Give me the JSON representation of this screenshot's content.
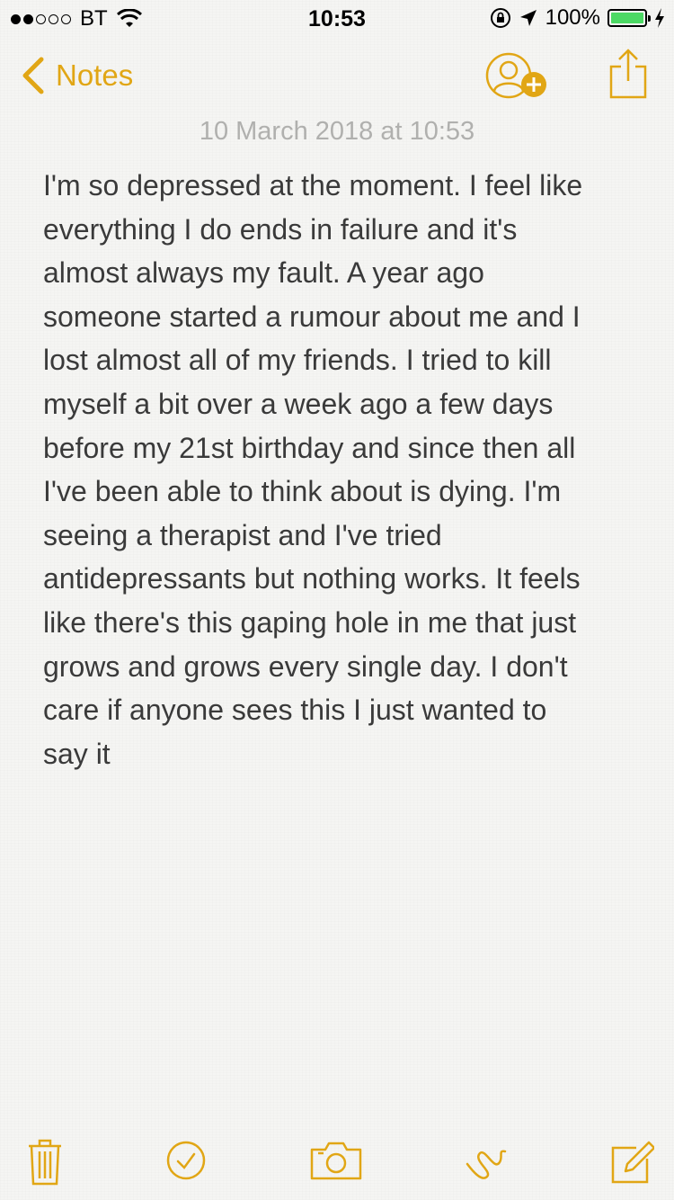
{
  "status_bar": {
    "carrier": "BT",
    "time": "10:53",
    "battery": "100%",
    "battery_level": 1.0,
    "signal_bars_filled": 2,
    "signal_bars_total": 5
  },
  "nav": {
    "back_label": "Notes"
  },
  "note": {
    "date": "10 March 2018 at 10:53",
    "body": "I'm so depressed at the moment. I feel like\neverything I do ends in failure and it's\nalmost always my fault. A year ago\nsomeone started a rumour about me and I\nlost almost all of my friends. I tried to kill\nmyself a bit over a week ago a few days\nbefore my 21st birthday and since then all\nI've been able to think about is dying. I'm\nseeing a therapist and I've tried\nantidepressants but nothing works. It feels\nlike there's this gaping hole in me that just\ngrows and grows every single day. I don't\ncare if anyone sees this I just wanted to\nsay it"
  },
  "colors": {
    "accent": "#e1a615",
    "battery_green": "#4cd964",
    "text": "#3a3a3a",
    "date_text": "#b0b0ae"
  },
  "icons": {
    "toolbar": [
      "trash-icon",
      "checklist-icon",
      "camera-icon",
      "sketch-icon",
      "compose-icon"
    ]
  }
}
